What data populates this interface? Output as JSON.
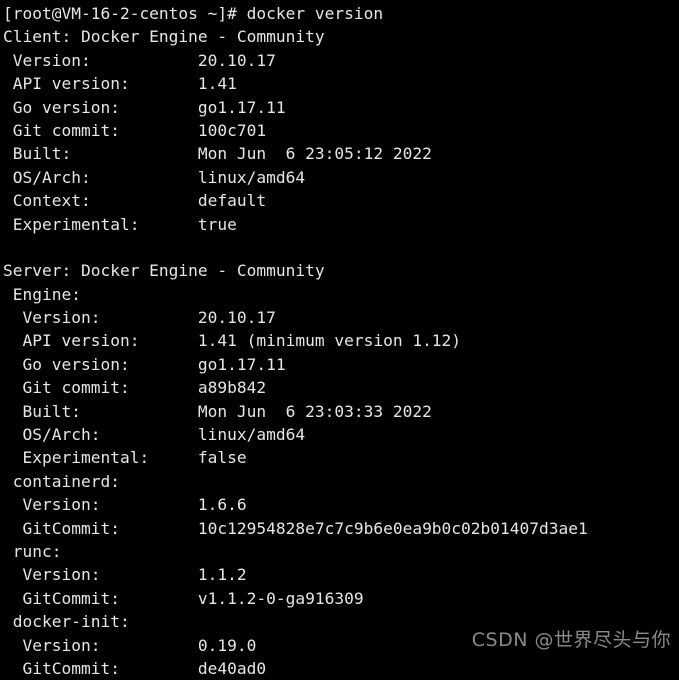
{
  "terminal": {
    "background_color": "#000000",
    "text_color": "#e6e6e6",
    "prompt": "[root@VM-16-2-centos ~]# docker version",
    "lines": [
      "[root@VM-16-2-centos ~]# docker version",
      "Client: Docker Engine - Community",
      " Version:           20.10.17",
      " API version:       1.41",
      " Go version:        go1.17.11",
      " Git commit:        100c701",
      " Built:             Mon Jun  6 23:05:12 2022",
      " OS/Arch:           linux/amd64",
      " Context:           default",
      " Experimental:      true",
      "",
      "Server: Docker Engine - Community",
      " Engine:",
      "  Version:          20.10.17",
      "  API version:      1.41 (minimum version 1.12)",
      "  Go version:       go1.17.11",
      "  Git commit:       a89b842",
      "  Built:            Mon Jun  6 23:03:33 2022",
      "  OS/Arch:          linux/amd64",
      "  Experimental:     false",
      " containerd:",
      "  Version:          1.6.6",
      "  GitCommit:        10c12954828e7c7c9b6e0ea9b0c02b01407d3ae1",
      " runc:",
      "  Version:          1.1.2",
      "  GitCommit:        v1.1.2-0-ga916309",
      " docker-init:",
      "  Version:          0.19.0",
      "  GitCommit:        de40ad0"
    ],
    "client": {
      "header": "Client: Docker Engine - Community",
      "version": "20.10.17",
      "api_version": "1.41",
      "go_version": "go1.17.11",
      "git_commit": "100c701",
      "built": "Mon Jun  6 23:05:12 2022",
      "os_arch": "linux/amd64",
      "context": "default",
      "experimental": "true"
    },
    "server": {
      "header": "Server: Docker Engine - Community",
      "engine": {
        "label": "Engine:",
        "version": "20.10.17",
        "api_version": "1.41 (minimum version 1.12)",
        "go_version": "go1.17.11",
        "git_commit": "a89b842",
        "built": "Mon Jun  6 23:03:33 2022",
        "os_arch": "linux/amd64",
        "experimental": "false"
      },
      "containerd": {
        "label": "containerd:",
        "version": "1.6.6",
        "git_commit": "10c12954828e7c7c9b6e0ea9b0c02b01407d3ae1"
      },
      "runc": {
        "label": "runc:",
        "version": "1.1.2",
        "git_commit": "v1.1.2-0-ga916309"
      },
      "docker_init": {
        "label": "docker-init:",
        "version": "0.19.0",
        "git_commit": "de40ad0"
      }
    }
  },
  "watermark": {
    "text": "CSDN @世界尽头与你",
    "color": "#8a8a8a"
  }
}
